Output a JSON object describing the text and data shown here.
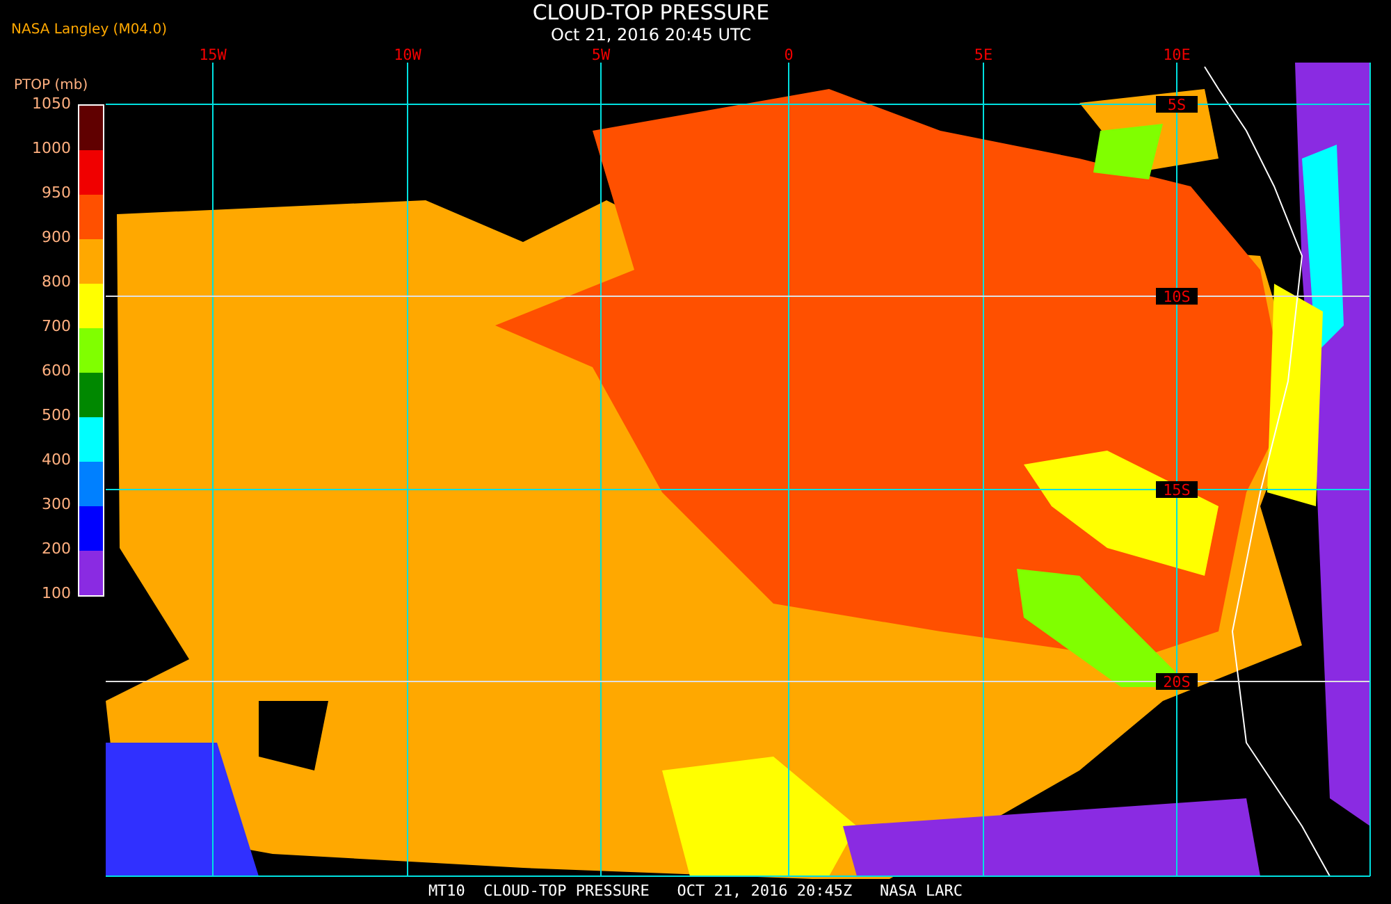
{
  "header": {
    "source": "NASA Langley (M04.0)",
    "title": "CLOUD-TOP PRESSURE",
    "subtitle": "Oct 21, 2016 20:45 UTC"
  },
  "legend": {
    "title": "PTOP (mb)",
    "ticks": [
      "1050",
      "1000",
      "950",
      "900",
      "800",
      "700",
      "600",
      "500",
      "400",
      "300",
      "200",
      "100"
    ],
    "bins": [
      {
        "color": "#600000"
      },
      {
        "color": "#f00000"
      },
      {
        "color": "#ff5000"
      },
      {
        "color": "#ffa800"
      },
      {
        "color": "#ffff00"
      },
      {
        "color": "#80ff00"
      },
      {
        "color": "#008800"
      },
      {
        "color": "#00ffff"
      },
      {
        "color": "#0080ff"
      },
      {
        "color": "#0000ff"
      },
      {
        "color": "#8a2be2"
      }
    ]
  },
  "map": {
    "lon_labels": [
      "15W",
      "10W",
      "5W",
      "0",
      "5E",
      "10E"
    ],
    "lat_labels": [
      "5S",
      "10S",
      "15S",
      "20S"
    ]
  },
  "footer": "MT10  CLOUD-TOP PRESSURE   OCT 21, 2016 20:45Z   NASA LARC"
}
